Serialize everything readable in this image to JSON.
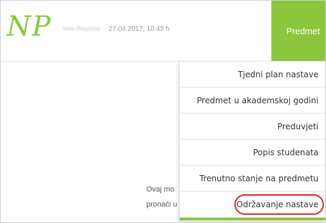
{
  "header": {
    "logo_text": "NP",
    "user_name": "Ime Prezime",
    "timestamp": "27.04.2017, 10:45 h"
  },
  "nav": {
    "predmet_label": "Predmet"
  },
  "content": {
    "line1": "Ovaj mo",
    "line2": "pronaći u"
  },
  "menu": {
    "items": [
      {
        "label": "Tjedni plan nastave"
      },
      {
        "label": "Predmet u akademskoj godini"
      },
      {
        "label": "Preduvjeti"
      },
      {
        "label": "Popis studenata"
      },
      {
        "label": "Trenutno stanje na predmetu"
      },
      {
        "label": "Održavanje nastave"
      }
    ]
  },
  "colors": {
    "accent": "#8cc63f",
    "highlight": "#d9251c"
  }
}
